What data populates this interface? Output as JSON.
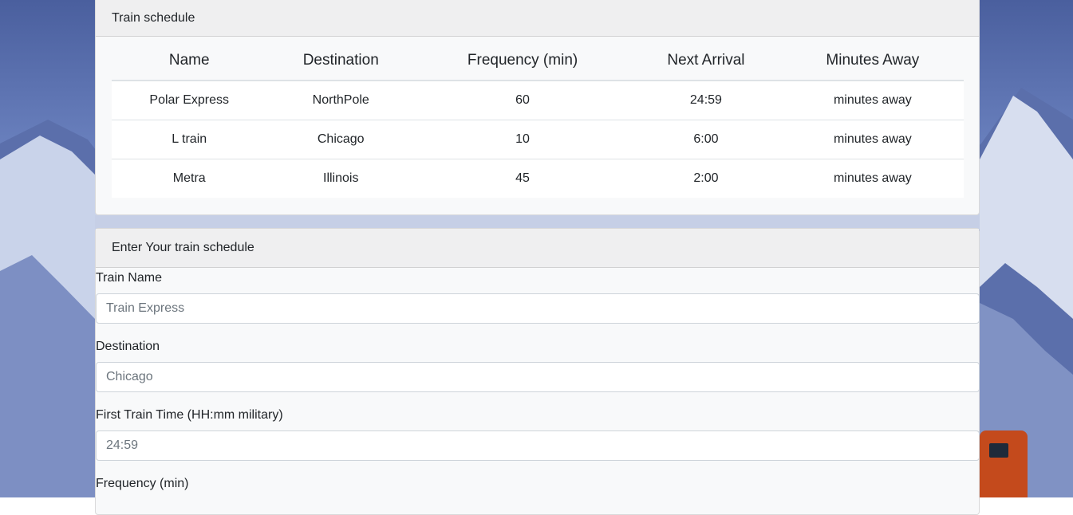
{
  "schedule": {
    "header": "Train schedule",
    "columns": [
      "Name",
      "Destination",
      "Frequency (min)",
      "Next Arrival",
      "Minutes Away"
    ],
    "rows": [
      [
        "Polar Express",
        "NorthPole",
        "60",
        "24:59",
        "minutes away"
      ],
      [
        "L train",
        "Chicago",
        "10",
        "6:00",
        "minutes away"
      ],
      [
        "Metra",
        "Illinois",
        "45",
        "2:00",
        "minutes away"
      ]
    ]
  },
  "form": {
    "header": "Enter Your train schedule",
    "fields": [
      {
        "label": "Train Name",
        "placeholder": "Train Express"
      },
      {
        "label": "Destination",
        "placeholder": "Chicago"
      },
      {
        "label": "First Train Time (HH:mm military)",
        "placeholder": "24:59"
      },
      {
        "label": "Frequency (min)",
        "placeholder": ""
      }
    ]
  },
  "colors": {
    "card_background": "#f8f9fa",
    "card_header": "#efeff0",
    "border": "#dee2e6",
    "sky_blue": "#6f86c3",
    "train_orange": "#c44a1c"
  }
}
